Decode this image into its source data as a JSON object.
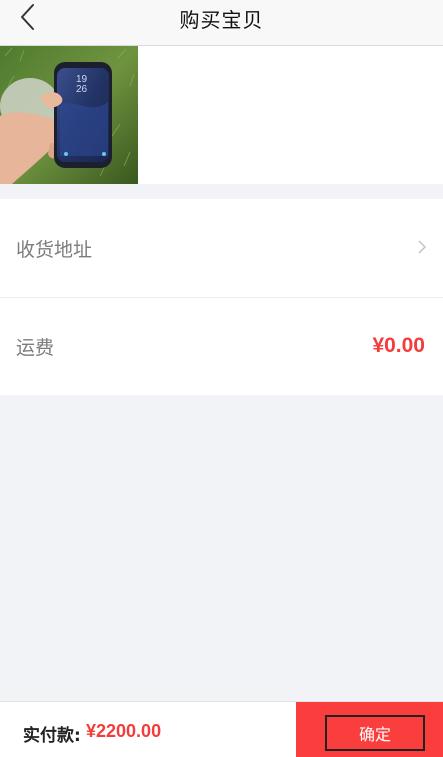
{
  "nav": {
    "title": "购买宝贝",
    "back_icon": "chevron-left-icon"
  },
  "product": {
    "image": "phone-in-hand-photo"
  },
  "address_row": {
    "label": "收货地址",
    "icon": "chevron-right-icon"
  },
  "shipping_row": {
    "label": "运费",
    "value": "¥0.00"
  },
  "bottom_bar": {
    "pay_label": "实付款:",
    "pay_amount": "¥2200.00",
    "confirm_label": "确定"
  },
  "colors": {
    "accent": "#f43c3c",
    "button_bg": "#fa3e3e",
    "page_bg": "#f2f3f7"
  }
}
